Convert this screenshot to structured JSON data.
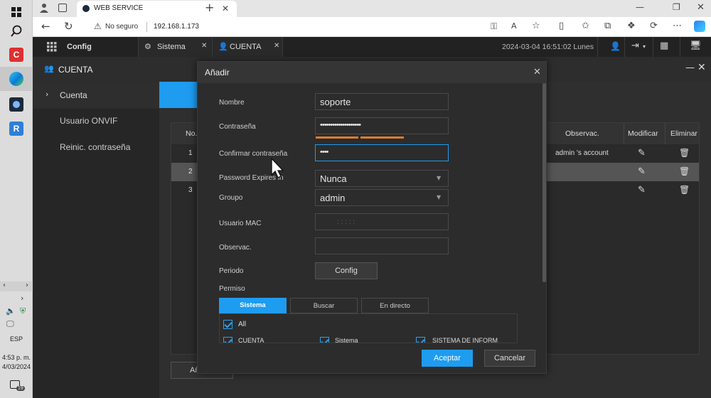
{
  "taskbar": {
    "time": "4:53 p. m.",
    "date": "4/03/2024",
    "lang": "ESP",
    "notification_count": "19"
  },
  "browser": {
    "tab_title": "WEB SERVICE",
    "security_label": "No seguro",
    "url": "192.168.1.173"
  },
  "app": {
    "config_label": "Config",
    "tabs": [
      {
        "label": "Sistema"
      },
      {
        "label": "CUENTA"
      }
    ],
    "datetime": "2024-03-04 16:51:02 Lunes",
    "page_title": "CUENTA"
  },
  "sidebar": {
    "items": [
      {
        "label": "Cuenta"
      },
      {
        "label": "Usuario ONVIF"
      },
      {
        "label": "Reinic. contraseña"
      }
    ]
  },
  "table": {
    "headers": {
      "no": "No.",
      "observ": "Observac.",
      "modify": "Modificar",
      "delete": "Eliminar"
    },
    "rows": [
      {
        "no": "1",
        "observ": "admin 's account"
      },
      {
        "no": "2",
        "observ": ""
      },
      {
        "no": "3",
        "observ": ""
      }
    ],
    "add_button_partial": "Añ"
  },
  "modal": {
    "title": "Añadir",
    "labels": {
      "name": "Nombre",
      "password": "Contraseña",
      "confirm": "Confirmar contraseña",
      "expires": "Password Expires in",
      "group": "Groupo",
      "mac": "Usuario MAC",
      "observ": "Observac.",
      "period": "Periodo",
      "permission": "Permiso"
    },
    "values": {
      "name": "soporte",
      "password": "••••••••••••••••••••",
      "confirm": "••••",
      "expires": "Nunca",
      "group": "admin",
      "mac": ":       :       :       :       :",
      "observ": ""
    },
    "config_button": "Config",
    "perm_tabs": [
      {
        "label": "Sistema"
      },
      {
        "label": "Buscar"
      },
      {
        "label": "En directo"
      }
    ],
    "perm_all": "All",
    "perm_items": [
      {
        "label": "CUENTA"
      },
      {
        "label": "Sistema"
      },
      {
        "label": "SISTEMA DE INFORM"
      }
    ],
    "accept": "Aceptar",
    "cancel": "Cancelar"
  },
  "colors": {
    "accent": "#1e9cf0",
    "strength": "#e07a2c"
  }
}
